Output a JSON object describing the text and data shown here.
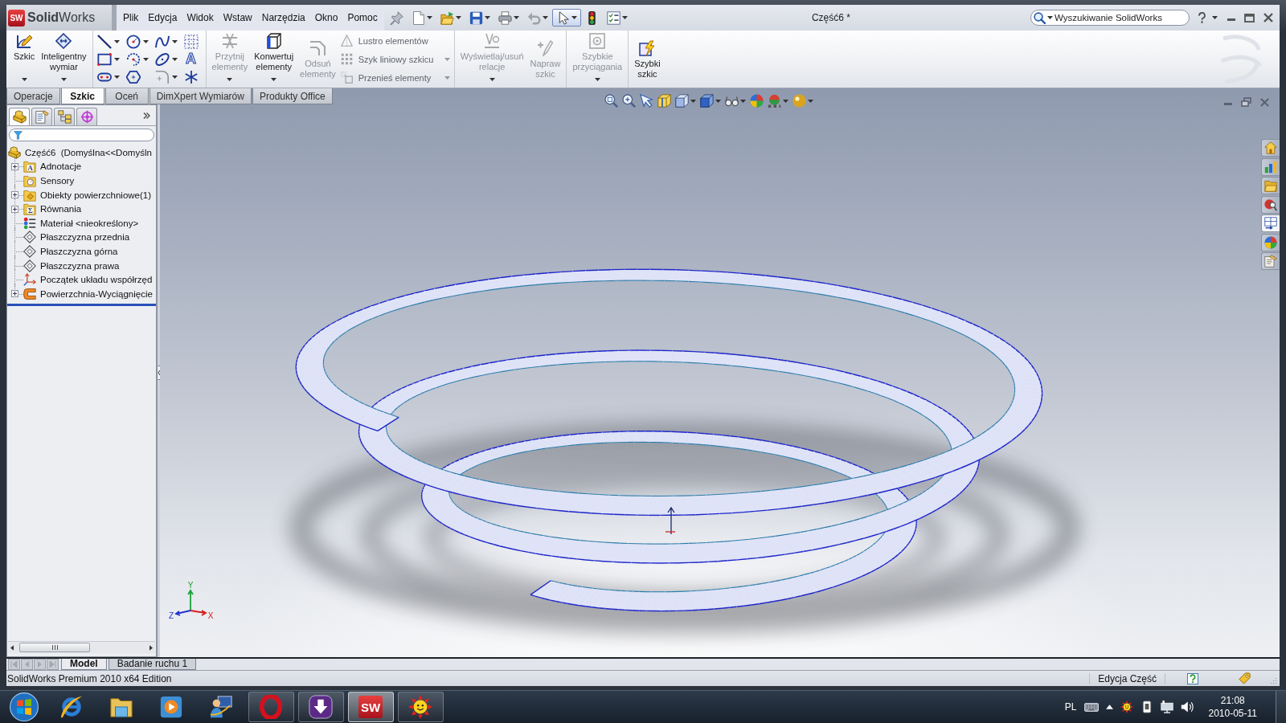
{
  "window": {
    "logo_mark": "SW",
    "app_name": "**Solid**Works",
    "title": "Część6 *"
  },
  "menu": [
    "Plik",
    "Edycja",
    "Widok",
    "Wstaw",
    "Narzędzia",
    "Okno",
    "Pomoc"
  ],
  "quick_access": [
    {
      "dropdown": false,
      "disabled": false,
      "selected": false
    },
    {
      "dropdown": true,
      "disabled": false,
      "selected": false
    },
    {
      "dropdown": true,
      "disabled": false,
      "selected": false
    },
    {
      "dropdown": true,
      "disabled": false,
      "selected": false
    },
    {
      "dropdown": true,
      "disabled": false,
      "selected": false
    },
    {
      "dropdown": true,
      "disabled": true,
      "selected": false
    },
    {
      "dropdown": true,
      "disabled": false,
      "selected": true
    },
    {
      "dropdown": false,
      "disabled": false,
      "selected": false
    },
    {
      "dropdown": true,
      "disabled": false,
      "selected": false
    }
  ],
  "search": {
    "placeholder": "Wyszukiwanie SolidWorks"
  },
  "ribbon": [
    {
      "tools": [
        {
          "kind": "large",
          "label": "Szkic",
          "disabled": false,
          "dropdown": true
        },
        {
          "kind": "large",
          "label": "Inteligentny wymiar",
          "disabled": false,
          "dropdown": true
        }
      ]
    },
    {
      "tools": [
        {
          "kind": "grid",
          "items": [
            {
              "dropdown": true,
              "disabled": false
            },
            {
              "dropdown": true,
              "disabled": false
            },
            {
              "dropdown": true,
              "disabled": false
            },
            {
              "dropdown": false,
              "disabled": false
            },
            {
              "dropdown": true,
              "disabled": false
            },
            {
              "dropdown": true,
              "disabled": false
            },
            {
              "dropdown": true,
              "disabled": false
            },
            {
              "glyph": "A",
              "dropdown": false,
              "disabled": false
            },
            {
              "dropdown": true,
              "disabled": false
            },
            {
              "dropdown": false,
              "disabled": false
            },
            {
              "dropdown": true,
              "disabled": true
            },
            {
              "dropdown": false,
              "disabled": false
            }
          ]
        }
      ]
    },
    {
      "tools": [
        {
          "kind": "large",
          "label": "Przytnij elementy",
          "disabled": true,
          "dropdown": true
        },
        {
          "kind": "large",
          "label": "Konwertuj elementy",
          "disabled": false,
          "dropdown": true
        },
        {
          "kind": "large",
          "label": "Odsuń elementy",
          "disabled": true,
          "dropdown": false
        },
        {
          "kind": "list",
          "items": [
            {
              "label": "Lustro elementów",
              "disabled": true,
              "dropdown": false
            },
            {
              "label": "Szyk liniowy szkicu",
              "disabled": true,
              "dropdown": true
            },
            {
              "label": "Przenieś elementy",
              "disabled": true,
              "dropdown": true
            }
          ]
        }
      ]
    },
    {
      "tools": [
        {
          "kind": "large",
          "label": "Wyświetlaj/usuń relacje",
          "disabled": true,
          "dropdown": true
        },
        {
          "kind": "large",
          "label": "Napraw szkic",
          "disabled": true,
          "dropdown": false
        }
      ]
    },
    {
      "tools": [
        {
          "kind": "large",
          "label": "Szybkie przyciągania",
          "disabled": true,
          "dropdown": true
        }
      ]
    },
    {
      "tools": [
        {
          "kind": "large",
          "label": "Szybki szkic",
          "disabled": false,
          "dropdown": false
        }
      ]
    }
  ],
  "tabs": [
    {
      "label": "Operacje",
      "selected": false
    },
    {
      "label": "Szkic",
      "selected": true
    },
    {
      "label": "Oceń",
      "selected": false
    },
    {
      "label": "DimXpert Wymiarów",
      "selected": false
    },
    {
      "label": "Produkty Office",
      "selected": false
    }
  ],
  "feature_tree": {
    "panel_tabs": [
      {
        "selected": true
      },
      {
        "selected": false
      },
      {
        "selected": false
      },
      {
        "selected": false
      }
    ],
    "root": {
      "label": "Część6  (Domyślna<<Domyśln",
      "children": [
        {
          "label": "Adnotacje",
          "kind": "folder",
          "emblem": "A",
          "expandable": true
        },
        {
          "label": "Sensory",
          "kind": "sensors",
          "expandable": false
        },
        {
          "label": "Obiekty powierzchniowe(1)",
          "kind": "bodies",
          "expandable": true
        },
        {
          "label": "Równania",
          "kind": "folder",
          "emblem": "Σ",
          "expandable": true
        },
        {
          "label": "Materiał <nieokreślony>",
          "kind": "material",
          "expandable": false
        },
        {
          "label": "Płaszczyzna przednia",
          "kind": "plane",
          "expandable": false
        },
        {
          "label": "Płaszczyzna górna",
          "kind": "plane",
          "expandable": false
        },
        {
          "label": "Płaszczyzna prawa",
          "kind": "plane",
          "expandable": false
        },
        {
          "label": "Początek układu współrzęd",
          "kind": "origin",
          "expandable": false
        },
        {
          "label": "Powierzchnia-Wyciągnięcie",
          "kind": "feature",
          "expandable": true
        }
      ]
    }
  },
  "graphics": {
    "view_tools": [
      {
        "dropdown": false
      },
      {
        "dropdown": false
      },
      {
        "dropdown": false
      },
      {
        "dropdown": false
      },
      {
        "dropdown": true
      },
      {
        "dropdown": true
      },
      {
        "dropdown": true
      },
      {
        "dropdown": false
      },
      {
        "dropdown": true
      },
      {
        "dropdown": true
      }
    ],
    "task_pane": [
      {
        "selected": false
      },
      {
        "selected": false
      },
      {
        "selected": false
      },
      {
        "selected": false
      },
      {
        "selected": true
      },
      {
        "selected": false
      },
      {
        "selected": false
      }
    ],
    "axis_triad": {
      "x": "X",
      "y": "Y",
      "z": "Z"
    }
  },
  "bottom_tabs": [
    {
      "label": "Model",
      "selected": true
    },
    {
      "label": "Badanie ruchu 1",
      "selected": false
    }
  ],
  "status_bar": {
    "product": "SolidWorks Premium 2010 x64 Edition",
    "mode": "Edycja Część"
  },
  "taskbar": {
    "apps": [
      {
        "running": false,
        "selected": false
      },
      {
        "running": false,
        "selected": false
      },
      {
        "running": false,
        "selected": false
      },
      {
        "running": false,
        "selected": false
      },
      {
        "running": true,
        "selected": false
      },
      {
        "running": true,
        "selected": false
      },
      {
        "glyph": "SW",
        "running": true,
        "selected": true
      },
      {
        "running": true,
        "selected": false
      }
    ],
    "tray": {
      "language": "PL",
      "time": "21:08",
      "date": "2010-05-11"
    }
  }
}
